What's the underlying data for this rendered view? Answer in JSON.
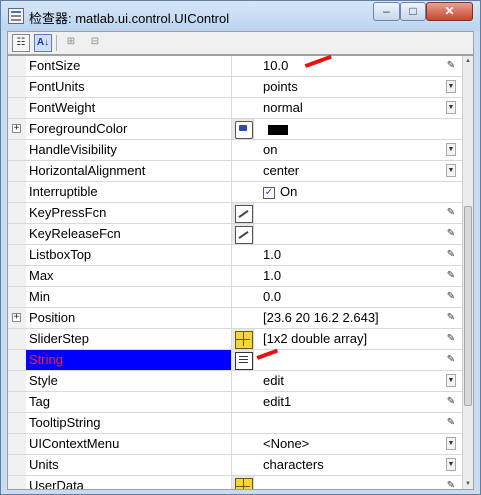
{
  "window": {
    "title": "检查器: matlab.ui.control.UIControl",
    "minimize": "–",
    "maximize": "□",
    "close": "✕"
  },
  "toolbar": {
    "categorized_icon": "categorized-icon",
    "alphabetical_icon": "alphabetical-icon",
    "alphabetical_label": "A↓",
    "expand_icon": "expand-icon",
    "collapse_icon": "collapse-icon"
  },
  "properties": [
    {
      "name": "FontSize",
      "value": "10.0",
      "control": "pen"
    },
    {
      "name": "FontUnits",
      "value": "points",
      "control": "dropdown"
    },
    {
      "name": "FontWeight",
      "value": "normal",
      "control": "dropdown"
    },
    {
      "name": "ForegroundColor",
      "value": "",
      "expandable": true,
      "editor": "palette",
      "swatch_color": "#000000"
    },
    {
      "name": "HandleVisibility",
      "value": "on",
      "control": "dropdown"
    },
    {
      "name": "HorizontalAlignment",
      "value": "center",
      "control": "dropdown"
    },
    {
      "name": "Interruptible",
      "value": "On",
      "checkbox": true
    },
    {
      "name": "KeyPressFcn",
      "value": "",
      "editor": "pen",
      "control": "pen"
    },
    {
      "name": "KeyReleaseFcn",
      "value": "",
      "editor": "pen",
      "control": "pen"
    },
    {
      "name": "ListboxTop",
      "value": "1.0",
      "control": "pen"
    },
    {
      "name": "Max",
      "value": "1.0",
      "control": "pen"
    },
    {
      "name": "Min",
      "value": "0.0",
      "control": "pen"
    },
    {
      "name": "Position",
      "value": "[23.6 20 16.2 2.643]",
      "expandable": true,
      "control": "pen"
    },
    {
      "name": "SliderStep",
      "value": "[1x2  double array]",
      "editor": "grid",
      "control": "pen"
    },
    {
      "name": "String",
      "value": "",
      "editor": "list",
      "control": "pen",
      "selected": true
    },
    {
      "name": "Style",
      "value": "edit",
      "control": "dropdown"
    },
    {
      "name": "Tag",
      "value": "edit1",
      "control": "pen"
    },
    {
      "name": "TooltipString",
      "value": "",
      "control": "pen"
    },
    {
      "name": "UIContextMenu",
      "value": "<None>",
      "control": "dropdown"
    },
    {
      "name": "Units",
      "value": "characters",
      "control": "dropdown"
    },
    {
      "name": "UserData",
      "value": "",
      "editor": "grid",
      "control": "pen"
    }
  ],
  "colors": {
    "selected_row_bg": "#0000ff",
    "selected_row_text": "#ff2020",
    "annotation": "#e81010"
  }
}
